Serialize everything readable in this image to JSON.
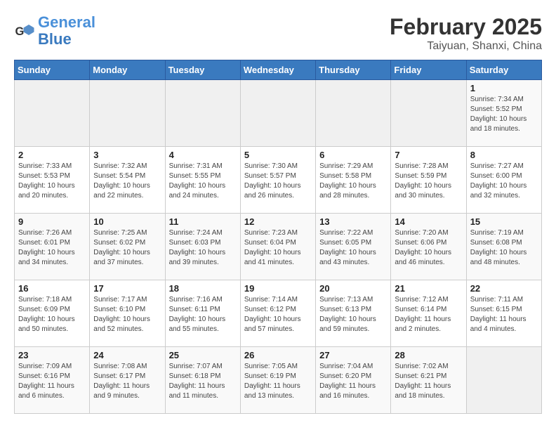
{
  "header": {
    "logo_general": "General",
    "logo_blue": "Blue",
    "title": "February 2025",
    "subtitle": "Taiyuan, Shanxi, China"
  },
  "weekdays": [
    "Sunday",
    "Monday",
    "Tuesday",
    "Wednesday",
    "Thursday",
    "Friday",
    "Saturday"
  ],
  "weeks": [
    [
      {
        "day": "",
        "info": ""
      },
      {
        "day": "",
        "info": ""
      },
      {
        "day": "",
        "info": ""
      },
      {
        "day": "",
        "info": ""
      },
      {
        "day": "",
        "info": ""
      },
      {
        "day": "",
        "info": ""
      },
      {
        "day": "1",
        "info": "Sunrise: 7:34 AM\nSunset: 5:52 PM\nDaylight: 10 hours\nand 18 minutes."
      }
    ],
    [
      {
        "day": "2",
        "info": "Sunrise: 7:33 AM\nSunset: 5:53 PM\nDaylight: 10 hours\nand 20 minutes."
      },
      {
        "day": "3",
        "info": "Sunrise: 7:32 AM\nSunset: 5:54 PM\nDaylight: 10 hours\nand 22 minutes."
      },
      {
        "day": "4",
        "info": "Sunrise: 7:31 AM\nSunset: 5:55 PM\nDaylight: 10 hours\nand 24 minutes."
      },
      {
        "day": "5",
        "info": "Sunrise: 7:30 AM\nSunset: 5:57 PM\nDaylight: 10 hours\nand 26 minutes."
      },
      {
        "day": "6",
        "info": "Sunrise: 7:29 AM\nSunset: 5:58 PM\nDaylight: 10 hours\nand 28 minutes."
      },
      {
        "day": "7",
        "info": "Sunrise: 7:28 AM\nSunset: 5:59 PM\nDaylight: 10 hours\nand 30 minutes."
      },
      {
        "day": "8",
        "info": "Sunrise: 7:27 AM\nSunset: 6:00 PM\nDaylight: 10 hours\nand 32 minutes."
      }
    ],
    [
      {
        "day": "9",
        "info": "Sunrise: 7:26 AM\nSunset: 6:01 PM\nDaylight: 10 hours\nand 34 minutes."
      },
      {
        "day": "10",
        "info": "Sunrise: 7:25 AM\nSunset: 6:02 PM\nDaylight: 10 hours\nand 37 minutes."
      },
      {
        "day": "11",
        "info": "Sunrise: 7:24 AM\nSunset: 6:03 PM\nDaylight: 10 hours\nand 39 minutes."
      },
      {
        "day": "12",
        "info": "Sunrise: 7:23 AM\nSunset: 6:04 PM\nDaylight: 10 hours\nand 41 minutes."
      },
      {
        "day": "13",
        "info": "Sunrise: 7:22 AM\nSunset: 6:05 PM\nDaylight: 10 hours\nand 43 minutes."
      },
      {
        "day": "14",
        "info": "Sunrise: 7:20 AM\nSunset: 6:06 PM\nDaylight: 10 hours\nand 46 minutes."
      },
      {
        "day": "15",
        "info": "Sunrise: 7:19 AM\nSunset: 6:08 PM\nDaylight: 10 hours\nand 48 minutes."
      }
    ],
    [
      {
        "day": "16",
        "info": "Sunrise: 7:18 AM\nSunset: 6:09 PM\nDaylight: 10 hours\nand 50 minutes."
      },
      {
        "day": "17",
        "info": "Sunrise: 7:17 AM\nSunset: 6:10 PM\nDaylight: 10 hours\nand 52 minutes."
      },
      {
        "day": "18",
        "info": "Sunrise: 7:16 AM\nSunset: 6:11 PM\nDaylight: 10 hours\nand 55 minutes."
      },
      {
        "day": "19",
        "info": "Sunrise: 7:14 AM\nSunset: 6:12 PM\nDaylight: 10 hours\nand 57 minutes."
      },
      {
        "day": "20",
        "info": "Sunrise: 7:13 AM\nSunset: 6:13 PM\nDaylight: 10 hours\nand 59 minutes."
      },
      {
        "day": "21",
        "info": "Sunrise: 7:12 AM\nSunset: 6:14 PM\nDaylight: 11 hours\nand 2 minutes."
      },
      {
        "day": "22",
        "info": "Sunrise: 7:11 AM\nSunset: 6:15 PM\nDaylight: 11 hours\nand 4 minutes."
      }
    ],
    [
      {
        "day": "23",
        "info": "Sunrise: 7:09 AM\nSunset: 6:16 PM\nDaylight: 11 hours\nand 6 minutes."
      },
      {
        "day": "24",
        "info": "Sunrise: 7:08 AM\nSunset: 6:17 PM\nDaylight: 11 hours\nand 9 minutes."
      },
      {
        "day": "25",
        "info": "Sunrise: 7:07 AM\nSunset: 6:18 PM\nDaylight: 11 hours\nand 11 minutes."
      },
      {
        "day": "26",
        "info": "Sunrise: 7:05 AM\nSunset: 6:19 PM\nDaylight: 11 hours\nand 13 minutes."
      },
      {
        "day": "27",
        "info": "Sunrise: 7:04 AM\nSunset: 6:20 PM\nDaylight: 11 hours\nand 16 minutes."
      },
      {
        "day": "28",
        "info": "Sunrise: 7:02 AM\nSunset: 6:21 PM\nDaylight: 11 hours\nand 18 minutes."
      },
      {
        "day": "",
        "info": ""
      }
    ]
  ]
}
